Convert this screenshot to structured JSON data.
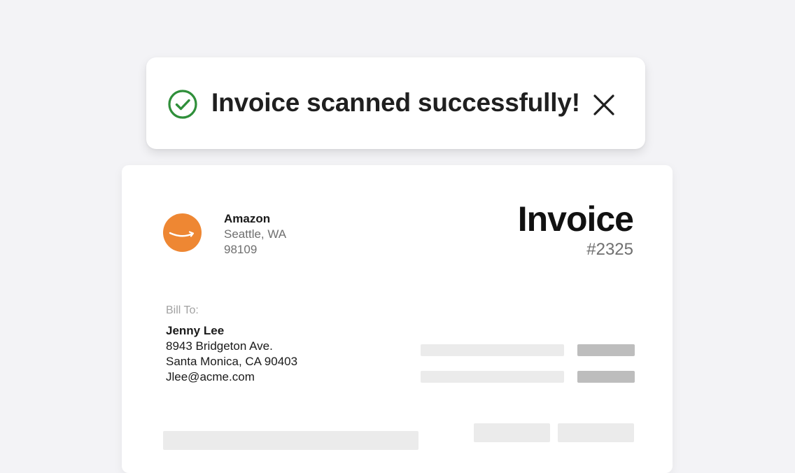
{
  "toast": {
    "message": "Invoice scanned successfully!",
    "success_icon": "check-circle-icon",
    "close_icon": "close-icon",
    "success_color": "#2f8f3a"
  },
  "invoice": {
    "vendor": {
      "name": "Amazon",
      "city_state": "Seattle, WA",
      "zip": "98109",
      "logo_icon": "amazon-smile-logo",
      "logo_color": "#ee8733"
    },
    "title": "Invoice",
    "number": "#2325",
    "bill_to": {
      "label": "Bill To:",
      "name": "Jenny Lee",
      "street": "8943 Bridgeton Ave.",
      "city_state_zip": "Santa Monica, CA 90403",
      "email": "Jlee@acme.com"
    }
  }
}
